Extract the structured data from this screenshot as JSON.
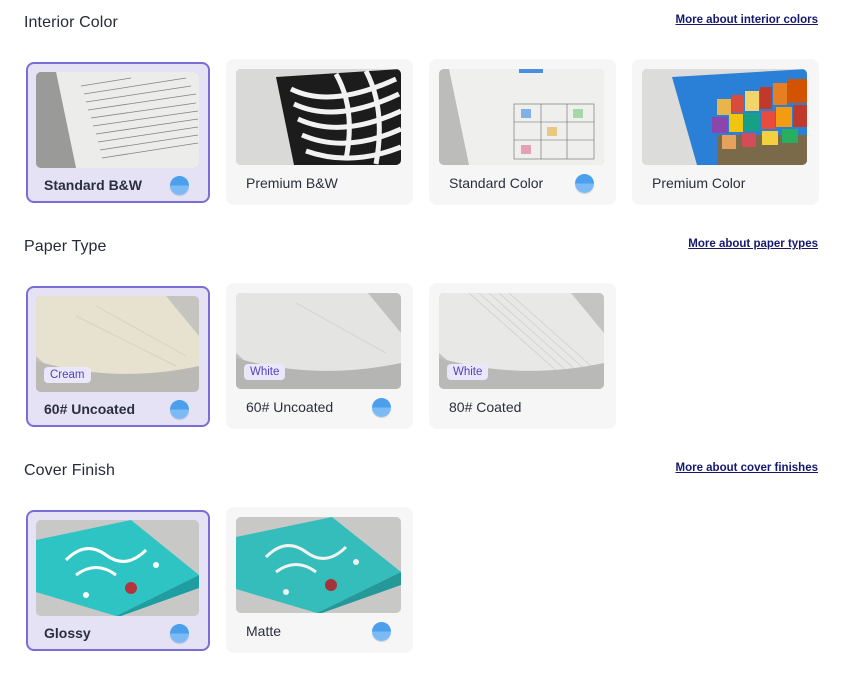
{
  "sections": [
    {
      "title": "Interior Color",
      "link": "More about interior colors",
      "options": [
        {
          "label": "Standard B&W",
          "selected": true,
          "info": true,
          "image": "interior-bw-book-image"
        },
        {
          "label": "Premium B&W",
          "selected": false,
          "info": false,
          "image": "zebra-photo-image"
        },
        {
          "label": "Standard Color",
          "selected": false,
          "info": true,
          "image": "color-worksheet-image"
        },
        {
          "label": "Premium Color",
          "selected": false,
          "info": false,
          "image": "colorful-village-photo-image"
        }
      ]
    },
    {
      "title": "Paper Type",
      "link": "More about paper types",
      "options": [
        {
          "label": "60# Uncoated",
          "badge": "Cream",
          "selected": true,
          "info": true,
          "image": "cream-paper-stack-image"
        },
        {
          "label": "60# Uncoated",
          "badge": "White",
          "selected": false,
          "info": true,
          "image": "white-paper-stack-image"
        },
        {
          "label": "80# Coated",
          "badge": "White",
          "selected": false,
          "info": false,
          "image": "white-coated-paper-stack-image"
        }
      ]
    },
    {
      "title": "Cover Finish",
      "link": "More about cover finishes",
      "options": [
        {
          "label": "Glossy",
          "selected": true,
          "info": true,
          "image": "glossy-book-cover-image"
        },
        {
          "label": "Matte",
          "selected": false,
          "info": true,
          "image": "matte-book-cover-image"
        }
      ]
    }
  ],
  "colors": {
    "selected_bg": "#e5e2f5",
    "selected_border": "#7a6ed6",
    "card_bg": "#f6f6f6",
    "link": "#16186e",
    "info_dot": "#4aa0ec",
    "badge_text": "#5043b8"
  }
}
